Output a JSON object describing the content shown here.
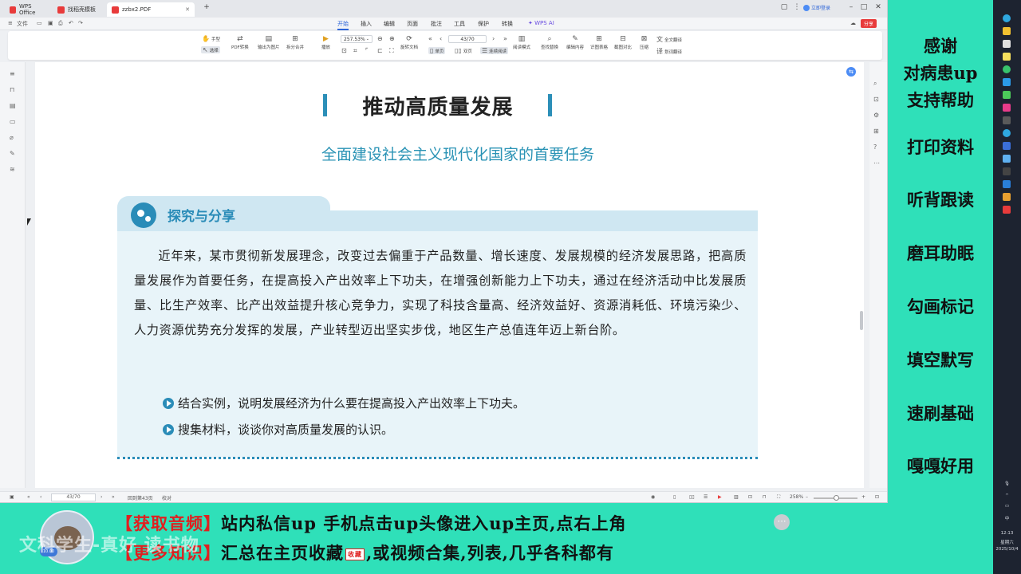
{
  "tabs": [
    {
      "label": "WPS Office",
      "color": "#e83b3b"
    },
    {
      "label": "找稻壳模板",
      "color": "#e83b3b"
    },
    {
      "label": "zzbx2.PDF",
      "color": "#e83b3b"
    }
  ],
  "window": {
    "login": "立即登录",
    "share": "分享"
  },
  "menu": {
    "file": "文件",
    "items": [
      "开始",
      "插入",
      "编辑",
      "页面",
      "批注",
      "工具",
      "保护",
      "转换"
    ],
    "active": "开始",
    "ai": "WPS AI"
  },
  "ribbon": {
    "hand": "手型",
    "select": "选择",
    "pdf_convert": "PDF转换",
    "export_image": "输出为图片",
    "split_merge": "拆分合并",
    "play": "播放",
    "zoom": "257.53%",
    "page": "43/70",
    "rotate": "旋转文档",
    "single": "单页",
    "double": "双页",
    "continuous": "连续阅读",
    "reading_mode": "阅读模式",
    "find_replace": "查找替换",
    "edit_content": "编辑内容",
    "extract_table": "识图表格",
    "screenshot_compare": "截图对比",
    "compress": "压缩",
    "full_translate": "全文翻译",
    "divide_translate": "划词翻译"
  },
  "document": {
    "title": "推动高质量发展",
    "subtitle": "全面建设社会主义现代化国家的首要任务",
    "callout_heading": "探究与分享",
    "body": "近年来，某市贯彻新发展理念，改变过去偏重于产品数量、增长速度、发展规模的经济发展思路，把高质量发展作为首要任务，在提高投入产出效率上下功夫，在增强创新能力上下功夫，通过在经济活动中比发展质量、比生产效率、比产出效益提升核心竞争力，实现了科技含量高、经济效益好、资源消耗低、环境污染少、人力资源优势充分发挥的发展，产业转型迈出坚实步伐，地区生产总值连年迈上新台阶。",
    "bullets": [
      "结合实例，说明发展经济为什么要在提高投入产出效率上下功夫。",
      "搜集材料，谈谈你对高质量发展的认识。"
    ]
  },
  "status": {
    "page": "43/70",
    "back_to": "回到第43页",
    "proofread": "校对",
    "zoom": "258%"
  },
  "promo": [
    "感谢",
    "对病患up",
    "支持帮助",
    "打印资料",
    "听背跟读",
    "磨耳助眠",
    "勾画标记",
    "填空默写",
    "速刷基础",
    "嘎嘎好用"
  ],
  "banner": {
    "line1_tag": "【获取音频】",
    "line1_text": "站内私信up 手机点击up头像进入up主页,点右上角",
    "line2_tag": "【更多知识】",
    "line2_text_a": "汇总在主页收藏",
    "fav": "收藏",
    "line2_text_b": ",或视频合集,列表,几乎各科都有",
    "watermark": "文科学生-真好 读书物",
    "avatar_tag": "10.00"
  },
  "taskbar": {
    "ime": "中",
    "time": "12:13",
    "weekday": "星期六",
    "date": "2025/10/4"
  }
}
